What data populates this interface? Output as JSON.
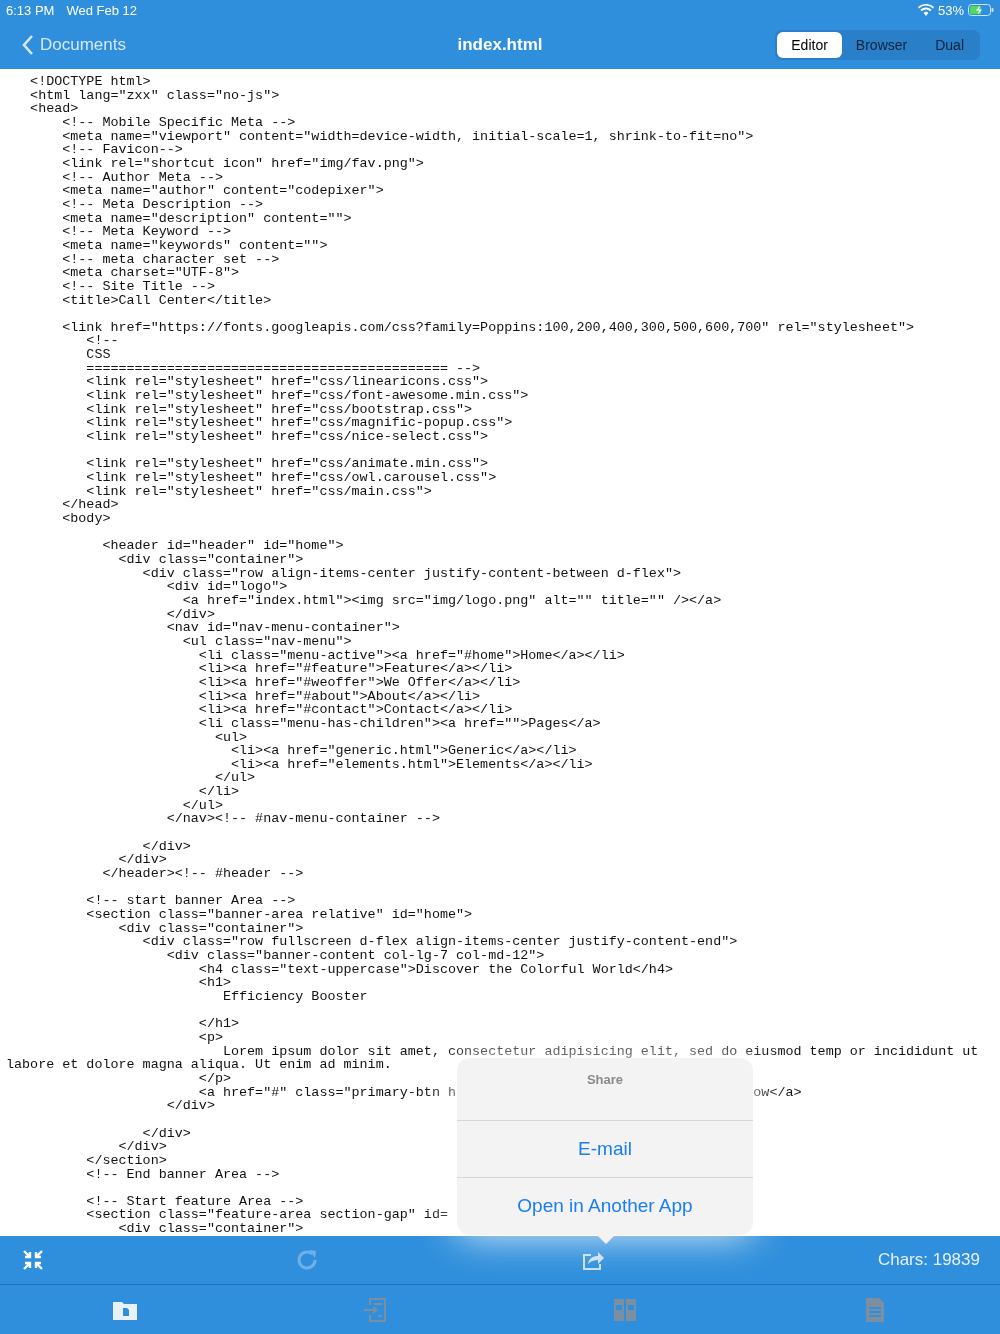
{
  "status_bar": {
    "time": "6:13 PM",
    "date": "Wed Feb 12",
    "battery": "53%"
  },
  "nav": {
    "back": "Documents",
    "title": "index.html",
    "segments": [
      {
        "label": "Editor",
        "selected": true
      },
      {
        "label": "Browser",
        "selected": false
      },
      {
        "label": "Dual",
        "selected": false
      }
    ]
  },
  "code": {
    "blocks": [
      {
        "lines": [
          "   <!DOCTYPE html>",
          "   <html lang=\"zxx\" class=\"no-js\">",
          "   <head>",
          "       <!-- Mobile Specific Meta -->",
          "       <meta name=\"viewport\" content=\"width=device-width, initial-scale=1, shrink-to-fit=no\">",
          "       <!-- Favicon-->",
          "       <link rel=\"shortcut icon\" href=\"img/fav.png\">",
          "       <!-- Author Meta -->",
          "       <meta name=\"author\" content=\"codepixer\">",
          "       <!-- Meta Description -->",
          "       <meta name=\"description\" content=\"\">",
          "       <!-- Meta Keyword -->",
          "       <meta name=\"keywords\" content=\"\">",
          "       <!-- meta character set -->",
          "       <meta charset=\"UTF-8\">",
          "       <!-- Site Title -->",
          "       <title>Call Center</title>"
        ]
      },
      {
        "lines": [
          "       <link href=\"https://fonts.googleapis.com/css?family=Poppins:100,200,400,300,500,600,700\" rel=\"stylesheet\">",
          "          <!--",
          "          CSS",
          "          ============================================= -->",
          "          <link rel=\"stylesheet\" href=\"css/linearicons.css\">",
          "          <link rel=\"stylesheet\" href=\"css/font-awesome.min.css\">",
          "          <link rel=\"stylesheet\" href=\"css/bootstrap.css\">",
          "          <link rel=\"stylesheet\" href=\"css/magnific-popup.css\">",
          "          <link rel=\"stylesheet\" href=\"css/nice-select.css\">"
        ]
      },
      {
        "lines": [
          "          <link rel=\"stylesheet\" href=\"css/animate.min.css\">",
          "          <link rel=\"stylesheet\" href=\"css/owl.carousel.css\">",
          "          <link rel=\"stylesheet\" href=\"css/main.css\">",
          "       </head>",
          "       <body>"
        ]
      },
      {
        "lines": [
          "            <header id=\"header\" id=\"home\">",
          "              <div class=\"container\">",
          "                 <div class=\"row align-items-center justify-content-between d-flex\">",
          "                    <div id=\"logo\">",
          "                      <a href=\"index.html\"><img src=\"img/logo.png\" alt=\"\" title=\"\" /></a>",
          "                    </div>",
          "                    <nav id=\"nav-menu-container\">",
          "                      <ul class=\"nav-menu\">",
          "                        <li class=\"menu-active\"><a href=\"#home\">Home</a></li>",
          "                        <li><a href=\"#feature\">Feature</a></li>",
          "                        <li><a href=\"#weoffer\">We Offer</a></li>",
          "                        <li><a href=\"#about\">About</a></li>",
          "                        <li><a href=\"#contact\">Contact</a></li>",
          "                        <li class=\"menu-has-children\"><a href=\"\">Pages</a>",
          "                          <ul>",
          "                            <li><a href=\"generic.html\">Generic</a></li>",
          "                            <li><a href=\"elements.html\">Elements</a></li>",
          "                          </ul>",
          "                        </li>",
          "                      </ul>",
          "                    </nav><!-- #nav-menu-container -->"
        ]
      },
      {
        "lines": [
          "                 </div>",
          "              </div>",
          "            </header><!-- #header -->"
        ]
      },
      {
        "lines": [
          "          <!-- start banner Area -->",
          "          <section class=\"banner-area relative\" id=\"home\">",
          "              <div class=\"container\">",
          "                 <div class=\"row fullscreen d-flex align-items-center justify-content-end\">",
          "                    <div class=\"banner-content col-lg-7 col-md-12\">",
          "                        <h4 class=\"text-uppercase\">Discover the Colorful World</h4>",
          "                        <h1>",
          "                           Efficiency Booster"
        ]
      },
      {
        "lines": [
          "                        </h1>",
          "                        <p>",
          "                           Lorem ipsum dolor sit amet, consectetur adipisicing elit, sed do eiusmod temp or incididunt ut",
          "labore et dolore magna aliqua. Ut enim ad minim.",
          "                        </p>",
          {
            "text": "                        <a href=\"#\" class=\"primary-btn h",
            "tail": "ow</a>"
          },
          "                    </div>"
        ]
      },
      {
        "lines": [
          "                 </div>",
          "              </div>",
          "          </section>",
          "          <!-- End banner Area -->"
        ]
      },
      {
        "lines": [
          "          <!-- Start feature Area -->",
          "          <section class=\"feature-area section-gap\" id=",
          "              <div class=\"container\">"
        ]
      }
    ]
  },
  "share_popover": {
    "title": "Share",
    "actions": [
      "E-mail",
      "Open in Another App"
    ]
  },
  "toolbar": {
    "buttons": [
      {
        "kind": "collapse",
        "disabled": false
      },
      {
        "kind": "refresh",
        "disabled": true
      },
      {
        "kind": "share",
        "disabled": false
      }
    ],
    "chars": "Chars: 19839"
  },
  "tab_bar": {
    "items": [
      {
        "kind": "files",
        "selected": true
      },
      {
        "kind": "import",
        "selected": false
      },
      {
        "kind": "split",
        "selected": false
      },
      {
        "kind": "document",
        "selected": false
      }
    ]
  }
}
